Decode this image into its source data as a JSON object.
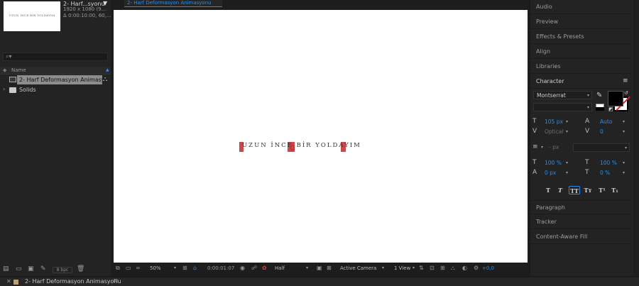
{
  "project": {
    "thumbnail_text": "UZUN İNCE BİR YOLDAYIM",
    "comp_name": "2- Harf...syonu",
    "comp_dropdown": "▼",
    "comp_resolution": "1920 x 1080  (9...",
    "comp_duration": "Δ 0:00:10:00, 60,...",
    "search_icon": "⌕▾",
    "column_name": "Name",
    "items": [
      {
        "label": "2- Harf Deformasyon Animasyonu",
        "type": "composition",
        "selected": true
      },
      {
        "label": "Solids",
        "type": "folder",
        "selected": false
      }
    ],
    "bpc": "8 bpc"
  },
  "viewer": {
    "tab_label": "2- Harf Deformasyon Animasyonu",
    "comp_text": "UZUN İNCE BİR YOLDAYIM",
    "canvas_color": "#ffffff",
    "highlight_color": "#c0282d",
    "toolbar": {
      "zoom": "50%",
      "timecode": "0:00:01:07",
      "resolution": "Half",
      "camera": "Active Camera",
      "views": "1 View",
      "exposure": "+0,0"
    }
  },
  "right_panels": {
    "headers": [
      "Audio",
      "Preview",
      "Effects & Presets",
      "Align",
      "Libraries",
      "Character"
    ],
    "footer_headers": [
      "Paragraph",
      "Tracker",
      "Content-Aware Fill"
    ],
    "character": {
      "font_family": "Montserrat",
      "font_style": "",
      "font_size": "105 px",
      "leading": "Auto",
      "kerning": "Optical",
      "tracking": "0",
      "stroke_width_unit": "- px",
      "vertical_scale": "100 %",
      "horizontal_scale": "100 %",
      "baseline_shift": "0 px",
      "tsume": "0 %",
      "fill_color": "#000000",
      "format_buttons": [
        "T",
        "T",
        "TT",
        "Tт",
        "T¹",
        "T₁"
      ]
    }
  },
  "timeline": {
    "tab_label": "2- Harf Deformasyon Animasyonu",
    "label_color": "#c0a070"
  },
  "accent": "#2d8ceb"
}
